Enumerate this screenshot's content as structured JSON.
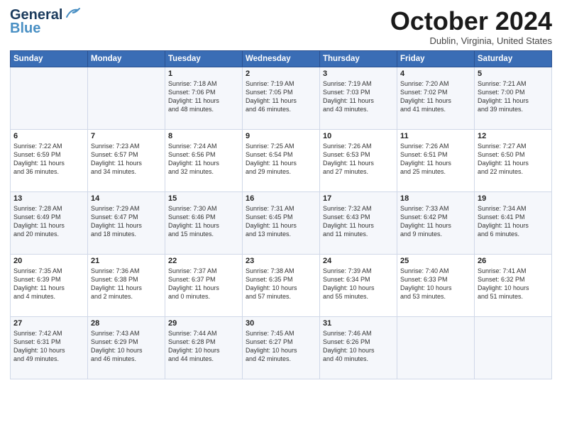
{
  "header": {
    "logo_general": "General",
    "logo_blue": "Blue",
    "month_title": "October 2024",
    "location": "Dublin, Virginia, United States"
  },
  "calendar": {
    "days_of_week": [
      "Sunday",
      "Monday",
      "Tuesday",
      "Wednesday",
      "Thursday",
      "Friday",
      "Saturday"
    ],
    "weeks": [
      [
        {
          "day": "",
          "info": ""
        },
        {
          "day": "",
          "info": ""
        },
        {
          "day": "1",
          "info": "Sunrise: 7:18 AM\nSunset: 7:06 PM\nDaylight: 11 hours\nand 48 minutes."
        },
        {
          "day": "2",
          "info": "Sunrise: 7:19 AM\nSunset: 7:05 PM\nDaylight: 11 hours\nand 46 minutes."
        },
        {
          "day": "3",
          "info": "Sunrise: 7:19 AM\nSunset: 7:03 PM\nDaylight: 11 hours\nand 43 minutes."
        },
        {
          "day": "4",
          "info": "Sunrise: 7:20 AM\nSunset: 7:02 PM\nDaylight: 11 hours\nand 41 minutes."
        },
        {
          "day": "5",
          "info": "Sunrise: 7:21 AM\nSunset: 7:00 PM\nDaylight: 11 hours\nand 39 minutes."
        }
      ],
      [
        {
          "day": "6",
          "info": "Sunrise: 7:22 AM\nSunset: 6:59 PM\nDaylight: 11 hours\nand 36 minutes."
        },
        {
          "day": "7",
          "info": "Sunrise: 7:23 AM\nSunset: 6:57 PM\nDaylight: 11 hours\nand 34 minutes."
        },
        {
          "day": "8",
          "info": "Sunrise: 7:24 AM\nSunset: 6:56 PM\nDaylight: 11 hours\nand 32 minutes."
        },
        {
          "day": "9",
          "info": "Sunrise: 7:25 AM\nSunset: 6:54 PM\nDaylight: 11 hours\nand 29 minutes."
        },
        {
          "day": "10",
          "info": "Sunrise: 7:26 AM\nSunset: 6:53 PM\nDaylight: 11 hours\nand 27 minutes."
        },
        {
          "day": "11",
          "info": "Sunrise: 7:26 AM\nSunset: 6:51 PM\nDaylight: 11 hours\nand 25 minutes."
        },
        {
          "day": "12",
          "info": "Sunrise: 7:27 AM\nSunset: 6:50 PM\nDaylight: 11 hours\nand 22 minutes."
        }
      ],
      [
        {
          "day": "13",
          "info": "Sunrise: 7:28 AM\nSunset: 6:49 PM\nDaylight: 11 hours\nand 20 minutes."
        },
        {
          "day": "14",
          "info": "Sunrise: 7:29 AM\nSunset: 6:47 PM\nDaylight: 11 hours\nand 18 minutes."
        },
        {
          "day": "15",
          "info": "Sunrise: 7:30 AM\nSunset: 6:46 PM\nDaylight: 11 hours\nand 15 minutes."
        },
        {
          "day": "16",
          "info": "Sunrise: 7:31 AM\nSunset: 6:45 PM\nDaylight: 11 hours\nand 13 minutes."
        },
        {
          "day": "17",
          "info": "Sunrise: 7:32 AM\nSunset: 6:43 PM\nDaylight: 11 hours\nand 11 minutes."
        },
        {
          "day": "18",
          "info": "Sunrise: 7:33 AM\nSunset: 6:42 PM\nDaylight: 11 hours\nand 9 minutes."
        },
        {
          "day": "19",
          "info": "Sunrise: 7:34 AM\nSunset: 6:41 PM\nDaylight: 11 hours\nand 6 minutes."
        }
      ],
      [
        {
          "day": "20",
          "info": "Sunrise: 7:35 AM\nSunset: 6:39 PM\nDaylight: 11 hours\nand 4 minutes."
        },
        {
          "day": "21",
          "info": "Sunrise: 7:36 AM\nSunset: 6:38 PM\nDaylight: 11 hours\nand 2 minutes."
        },
        {
          "day": "22",
          "info": "Sunrise: 7:37 AM\nSunset: 6:37 PM\nDaylight: 11 hours\nand 0 minutes."
        },
        {
          "day": "23",
          "info": "Sunrise: 7:38 AM\nSunset: 6:35 PM\nDaylight: 10 hours\nand 57 minutes."
        },
        {
          "day": "24",
          "info": "Sunrise: 7:39 AM\nSunset: 6:34 PM\nDaylight: 10 hours\nand 55 minutes."
        },
        {
          "day": "25",
          "info": "Sunrise: 7:40 AM\nSunset: 6:33 PM\nDaylight: 10 hours\nand 53 minutes."
        },
        {
          "day": "26",
          "info": "Sunrise: 7:41 AM\nSunset: 6:32 PM\nDaylight: 10 hours\nand 51 minutes."
        }
      ],
      [
        {
          "day": "27",
          "info": "Sunrise: 7:42 AM\nSunset: 6:31 PM\nDaylight: 10 hours\nand 49 minutes."
        },
        {
          "day": "28",
          "info": "Sunrise: 7:43 AM\nSunset: 6:29 PM\nDaylight: 10 hours\nand 46 minutes."
        },
        {
          "day": "29",
          "info": "Sunrise: 7:44 AM\nSunset: 6:28 PM\nDaylight: 10 hours\nand 44 minutes."
        },
        {
          "day": "30",
          "info": "Sunrise: 7:45 AM\nSunset: 6:27 PM\nDaylight: 10 hours\nand 42 minutes."
        },
        {
          "day": "31",
          "info": "Sunrise: 7:46 AM\nSunset: 6:26 PM\nDaylight: 10 hours\nand 40 minutes."
        },
        {
          "day": "",
          "info": ""
        },
        {
          "day": "",
          "info": ""
        }
      ]
    ]
  }
}
